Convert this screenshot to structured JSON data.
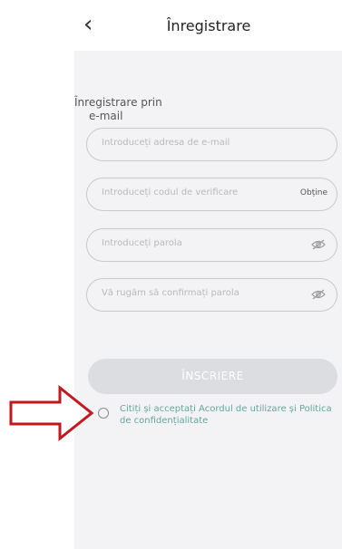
{
  "header": {
    "title": "Înregistrare",
    "back_icon": "chevron-left-icon"
  },
  "form": {
    "section_title_line1": "Înregistrare prin",
    "section_title_line2": "e-mail",
    "email": {
      "placeholder": "Introduceți adresa de e-mail",
      "value": ""
    },
    "code": {
      "placeholder": "Introduceți codul de verificare",
      "value": "",
      "get_code_label": "Obține"
    },
    "password": {
      "placeholder": "Introduceți parola",
      "value": "",
      "icon": "eye-icon"
    },
    "confirm_password": {
      "placeholder": "Vă rugăm să confirmați parola",
      "value": "",
      "icon": "eye-icon"
    },
    "submit_label": "ÎNSCRIERE",
    "agreement_text": "Citiți și acceptați Acordul de utilizare și Politica de confidențialitate"
  },
  "colors": {
    "accent": "#5fa89a",
    "button_disabled": "#dcdde1",
    "panel_bg": "#f3f3f5",
    "arrow": "#c0191e"
  },
  "annotation": {
    "icon": "red-outline-arrow-icon"
  }
}
